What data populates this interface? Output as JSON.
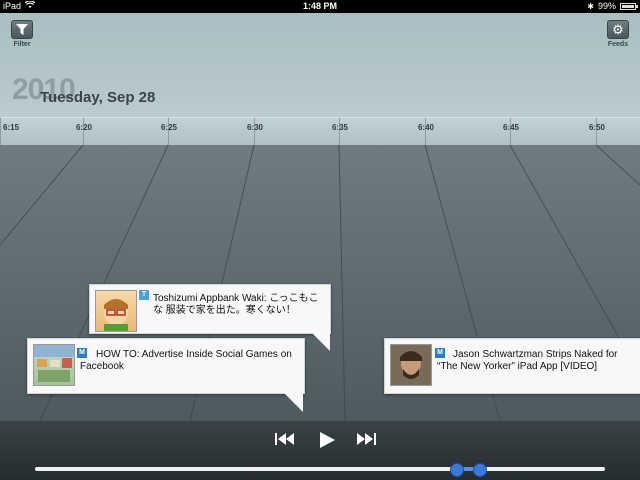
{
  "status_bar": {
    "device": "iPad",
    "time": "1:48 PM",
    "battery": "99%"
  },
  "toolbar": {
    "filter_label": "Filter",
    "feeds_label": "Feeds"
  },
  "header": {
    "year": "2010",
    "date": "Tuesday, Sep 28"
  },
  "timeline": {
    "ticks": [
      "6:15",
      "6:20",
      "6:25",
      "6:30",
      "6:35",
      "6:40",
      "6:45",
      "6:50"
    ]
  },
  "cards": [
    {
      "name": "toshizumi",
      "badge": "T",
      "text": "Toshizumi Appbank Waki: こっこもこな 服装で家を出た。寒くない！"
    },
    {
      "name": "howto",
      "badge": "M",
      "text": "HOW TO: Advertise Inside Social Games on Facebook"
    },
    {
      "name": "jason",
      "badge": "M",
      "text": "Jason Schwartzman Strips Naked for “The New Yorker” iPad App [VIDEO]"
    }
  ],
  "playback": {
    "prev_icon": "skip-back-icon",
    "play_icon": "play-icon",
    "next_icon": "skip-forward-icon"
  },
  "colors": {
    "accent": "#3c78d6",
    "header_bg": "#b6c7ca",
    "stage_bg": "#5e6b70"
  }
}
